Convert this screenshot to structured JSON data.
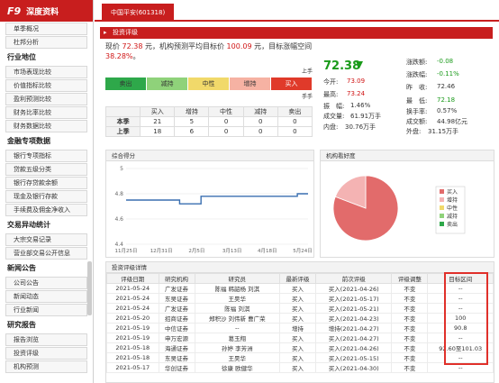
{
  "sidebar": {
    "brand": "F9",
    "title": "深度资料",
    "items": [
      {
        "type": "item",
        "label": "单季概况",
        "boxed": true
      },
      {
        "type": "item",
        "label": "杜邦分析",
        "boxed": true
      },
      {
        "type": "section",
        "label": "行业地位"
      },
      {
        "type": "item",
        "label": "市场表现比较",
        "boxed": true
      },
      {
        "type": "item",
        "label": "价值指标比较",
        "boxed": true
      },
      {
        "type": "item",
        "label": "盈利预测比较",
        "boxed": true
      },
      {
        "type": "item",
        "label": "财务比率比较",
        "boxed": true
      },
      {
        "type": "item",
        "label": "财务数据比较",
        "boxed": true
      },
      {
        "type": "section",
        "label": "金融专项数据"
      },
      {
        "type": "item",
        "label": "银行专项指标",
        "boxed": true
      },
      {
        "type": "item",
        "label": "贷款五级分类",
        "boxed": true
      },
      {
        "type": "item",
        "label": "银行存贷款余额",
        "boxed": true
      },
      {
        "type": "item",
        "label": "现金及银行存款",
        "boxed": true
      },
      {
        "type": "item",
        "label": "手续费及佣金净收入",
        "boxed": true
      },
      {
        "type": "section",
        "label": "交易异动统计"
      },
      {
        "type": "item",
        "label": "大宗交易记录",
        "boxed": true
      },
      {
        "type": "item",
        "label": "营业部交易公开信息",
        "boxed": true
      },
      {
        "type": "section",
        "label": "新闻公告"
      },
      {
        "type": "item",
        "label": "公司公告",
        "boxed": true
      },
      {
        "type": "item",
        "label": "新闻动态",
        "boxed": true
      },
      {
        "type": "item",
        "label": "行业新闻",
        "boxed": true
      },
      {
        "type": "section",
        "label": "研究报告"
      },
      {
        "type": "item",
        "label": "报告浏览",
        "boxed": true
      },
      {
        "type": "item",
        "label": "投资评级",
        "boxed": true
      },
      {
        "type": "item",
        "label": "机构预测",
        "boxed": true
      }
    ]
  },
  "tab": {
    "label": "中国平安(601318)"
  },
  "panel": {
    "title": "投资评级"
  },
  "summary": {
    "p1": "现价 ",
    "price": "72.38",
    "p2": " 元，机构预测平均目标价 ",
    "target": "100.09",
    "p3": " 元，目标涨幅空间",
    "space": "38.28%",
    "p4": "。"
  },
  "rating": {
    "up_label": "上手",
    "down_label": "手手",
    "segments": [
      {
        "label": "卖出",
        "color": "#2ea84a",
        "active": false
      },
      {
        "label": "减持",
        "color": "#8fd27a",
        "active": false
      },
      {
        "label": "中性",
        "color": "#f1d96a",
        "active": false
      },
      {
        "label": "增持",
        "color": "#f6b2a3",
        "active": false
      },
      {
        "label": "买入",
        "color": "#e03a2a",
        "active": true
      }
    ],
    "table": {
      "headers": [
        "",
        "买入",
        "增持",
        "中性",
        "减持",
        "卖出"
      ],
      "rows": [
        [
          "本季",
          "21",
          "5",
          "0",
          "0",
          "0"
        ],
        [
          "上季",
          "18",
          "6",
          "0",
          "0",
          "0"
        ]
      ]
    }
  },
  "price": {
    "current": "72.38",
    "today_open_label": "今开:",
    "today_open": "73.09",
    "high_label": "最高:",
    "high": "73.24",
    "amp_label": "振　幅:",
    "amp": "1.46%",
    "volume_label": "成交量:",
    "volume": "61.91万手",
    "inner_label": "内盘:",
    "inner": "30.76万手",
    "chg_label": "涨跌额:",
    "chg": "-0.08",
    "chgp_label": "涨跌幅:",
    "chgp": "-0.11%",
    "prev_label": "昨　收:",
    "prev": "72.46",
    "low_label": "最　低:",
    "low": "72.18",
    "turnover_label": "换手率:",
    "turnover": "0.57%",
    "amount_label": "成交额:",
    "amount": "44.98亿元",
    "outer_label": "外盘:",
    "outer": "31.15万手"
  },
  "trend": {
    "title": "综合得分",
    "yticks": [
      "5",
      "4.8",
      "4.6",
      "4.4"
    ],
    "xticks": [
      "11月25日",
      "12月31日",
      "2月5日",
      "3月13日",
      "4月18日",
      "5月24日"
    ],
    "color": "#3a6fb0"
  },
  "pie": {
    "title": "机构看好度",
    "legend": [
      {
        "label": "买入",
        "color": "#e26b6b"
      },
      {
        "label": "增持",
        "color": "#f4b3b3"
      },
      {
        "label": "中性",
        "color": "#f1d96a"
      },
      {
        "label": "减持",
        "color": "#8fd27a"
      },
      {
        "label": "卖出",
        "color": "#2ea84a"
      }
    ]
  },
  "chart_data": [
    {
      "type": "line",
      "title": "综合得分",
      "x": [
        "11月25日",
        "12月31日",
        "2月5日",
        "3月13日",
        "4月18日",
        "5月24日"
      ],
      "series": [
        {
          "values": [
            4.75,
            4.75,
            4.75,
            4.75,
            4.75,
            4.72,
            4.72,
            4.78,
            4.78,
            4.78,
            4.78,
            4.78,
            4.78,
            4.78,
            4.78,
            4.78,
            4.8,
            4.8
          ]
        }
      ],
      "ylim": [
        4.4,
        5.0
      ],
      "grid": true
    },
    {
      "type": "pie",
      "title": "机构看好度",
      "categories": [
        "买入",
        "增持",
        "中性",
        "减持",
        "卖出"
      ],
      "values": [
        21,
        5,
        0,
        0,
        0
      ]
    }
  ],
  "detail": {
    "title": "投资评级详情",
    "headers": [
      "评级日期",
      "研究机构",
      "研究员",
      "最新评级",
      "前次评级",
      "评级调整",
      "目标区间"
    ],
    "rows": [
      [
        "2021-05-24",
        "广发证券",
        "陈福 韩韶杨 刘淇",
        "买入",
        "买入(2021-04-26)",
        "不变",
        "--"
      ],
      [
        "2021-05-24",
        "东吴证券",
        "王昊华",
        "买入",
        "买入(2021-05-17)",
        "不变",
        "--"
      ],
      [
        "2021-05-24",
        "广发证券",
        "陈福 刘淇",
        "买入",
        "买入(2021-05-21)",
        "不变",
        "--"
      ],
      [
        "2021-05-20",
        "招商证券",
        "郑积沙 刘伟新 曹广荣",
        "买入",
        "买入(2021-04-23)",
        "不变",
        "100"
      ],
      [
        "2021-05-19",
        "中信证券",
        "--",
        "增持",
        "增持(2021-04-27)",
        "不变",
        "90.8"
      ],
      [
        "2021-05-19",
        "申万宏源",
        "葛玉翔",
        "买入",
        "买入(2021-04-27)",
        "不变",
        "--"
      ],
      [
        "2021-05-18",
        "海通证券",
        "孙婷 李芳洲",
        "买入",
        "买入(2021-04-26)",
        "不变",
        "92.60至101.03"
      ],
      [
        "2021-05-18",
        "东吴证券",
        "王昊华",
        "买入",
        "买入(2021-05-15)",
        "不变",
        "--"
      ],
      [
        "2021-05-17",
        "华创证券",
        "徐康 欧健华",
        "买入",
        "买入(2021-04-30)",
        "不变",
        "--"
      ]
    ]
  }
}
